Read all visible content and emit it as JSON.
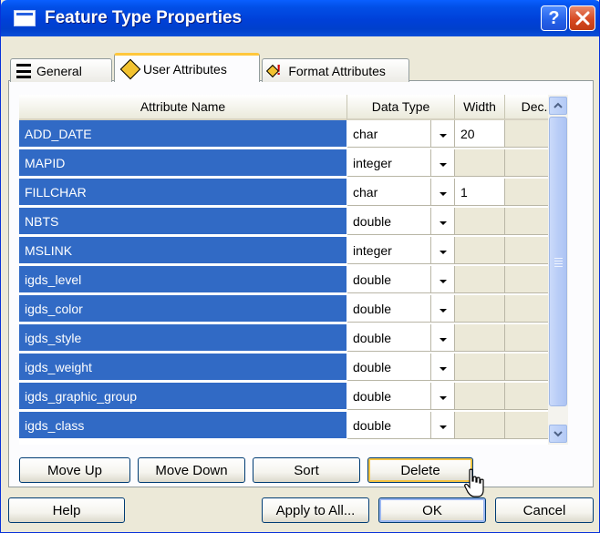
{
  "window": {
    "title": "Feature Type Properties"
  },
  "tabs": [
    {
      "label": "General",
      "icon": "list-icon"
    },
    {
      "label": "User Attributes",
      "icon": "diamond-icon",
      "active": true
    },
    {
      "label": "Format Attributes",
      "icon": "diamond-exclamation-icon"
    }
  ],
  "grid": {
    "columns": [
      "Attribute Name",
      "Data Type",
      "Width",
      "Dec."
    ],
    "rows": [
      {
        "name": "ADD_DATE",
        "type": "char",
        "width": "20"
      },
      {
        "name": "MAPID",
        "type": "integer",
        "width": ""
      },
      {
        "name": "FILLCHAR",
        "type": "char",
        "width": "1"
      },
      {
        "name": "NBTS",
        "type": "double",
        "width": ""
      },
      {
        "name": "MSLINK",
        "type": "integer",
        "width": ""
      },
      {
        "name": "igds_level",
        "type": "double",
        "width": ""
      },
      {
        "name": "igds_color",
        "type": "double",
        "width": ""
      },
      {
        "name": "igds_style",
        "type": "double",
        "width": ""
      },
      {
        "name": "igds_weight",
        "type": "double",
        "width": ""
      },
      {
        "name": "igds_graphic_group",
        "type": "double",
        "width": ""
      },
      {
        "name": "igds_class",
        "type": "double",
        "width": ""
      }
    ]
  },
  "buttons": {
    "move_up": "Move Up",
    "move_down": "Move Down",
    "sort": "Sort",
    "delete": "Delete",
    "help": "Help",
    "apply_to_all": "Apply to All...",
    "ok": "OK",
    "cancel": "Cancel"
  },
  "colors": {
    "selection": "#316AC5",
    "titlebar": "#0050E0",
    "dialog": "#ECE9D8"
  }
}
